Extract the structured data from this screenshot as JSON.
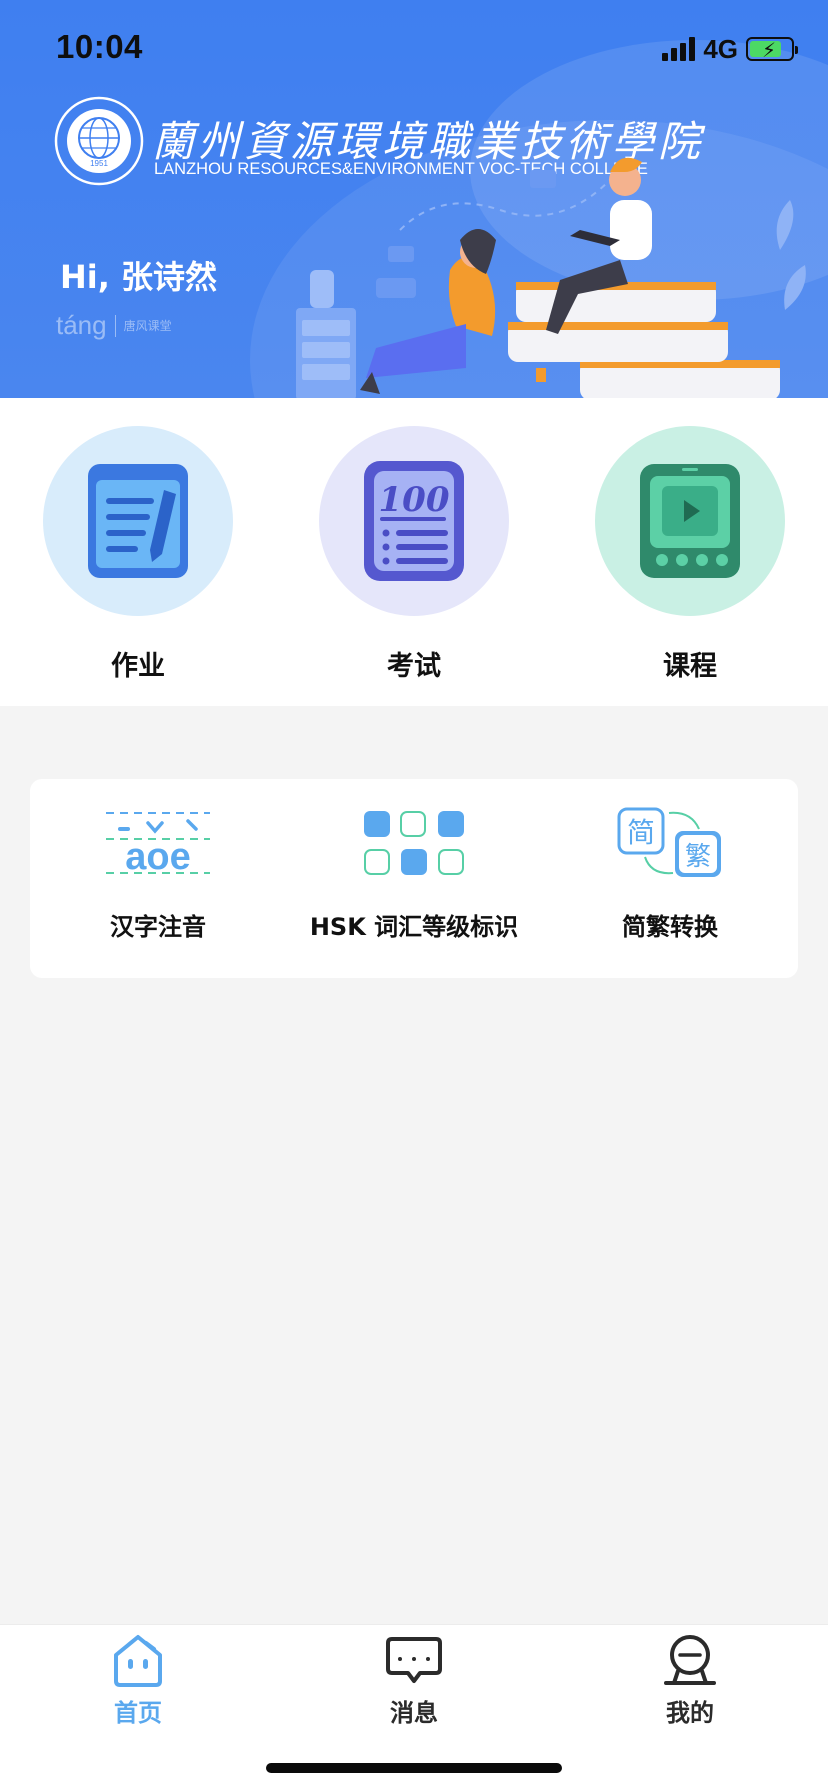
{
  "status_bar": {
    "time": "10:04",
    "network": "4G"
  },
  "header": {
    "college_name_cn": "蘭州資源環境職業技術學院",
    "college_name_en": "LANZHOU RESOURCES&ENVIRONMENT VOC-TECH COLLEGE",
    "logo_year": "1951",
    "greeting": "Hi, 张诗然",
    "brand_mark": "táng",
    "brand_sub": "唐风课堂"
  },
  "main_features": [
    {
      "label": "作业",
      "icon": "notebook-pen-icon"
    },
    {
      "label": "考试",
      "icon": "exam-paper-100-icon",
      "icon_text": "100"
    },
    {
      "label": "课程",
      "icon": "tablet-play-icon"
    }
  ],
  "tools": [
    {
      "label": "汉字注音",
      "icon": "pinyin-aoe-icon",
      "icon_text": "aoe"
    },
    {
      "label": "HSK 词汇等级标识",
      "icon": "grid-squares-icon"
    },
    {
      "label": "简繁转换",
      "icon": "simplified-traditional-icon",
      "icon_text_a": "简",
      "icon_text_b": "繁"
    }
  ],
  "tabbar": {
    "items": [
      {
        "label": "首页",
        "icon": "home-icon",
        "active": true
      },
      {
        "label": "消息",
        "icon": "message-icon",
        "active": false
      },
      {
        "label": "我的",
        "icon": "profile-icon",
        "active": false
      }
    ]
  },
  "colors": {
    "banner_blue": "#4a86ef",
    "active_tab": "#5aa8ee",
    "homework_circle": "#d8ecfb",
    "exam_circle": "#e5e6fa",
    "course_circle": "#c9f0e4"
  }
}
